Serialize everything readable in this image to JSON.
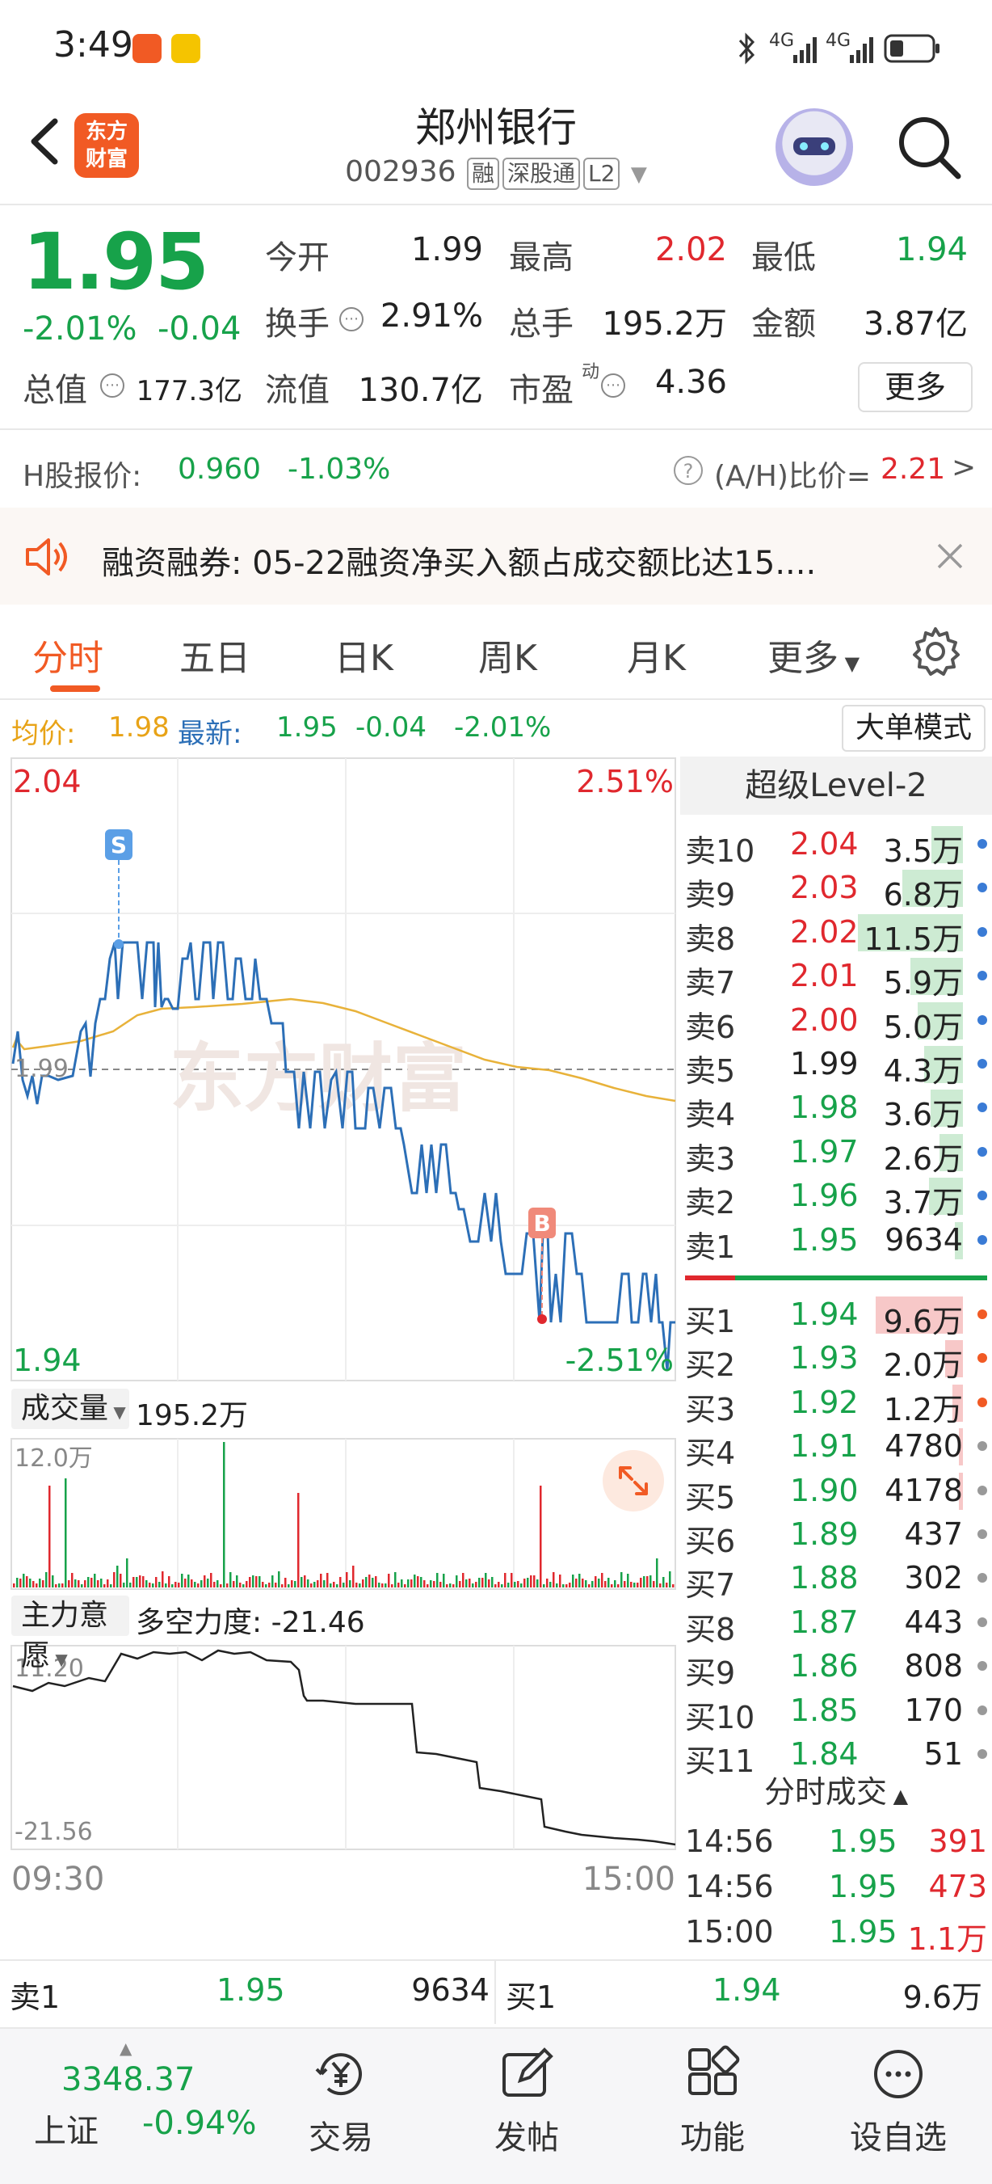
{
  "status_bar": {
    "time": "3:49",
    "signal_1": "4G",
    "signal_2": "4G"
  },
  "header": {
    "logo_line1": "东方",
    "logo_line2": "财富",
    "stock_name": "郑州银行",
    "stock_code": "002936",
    "tags": [
      "融",
      "深股通",
      "L2"
    ]
  },
  "quote": {
    "price": "1.95",
    "change_pct": "-2.01%",
    "change_abs": "-0.04",
    "open_label": "今开",
    "open": "1.99",
    "high_label": "最高",
    "high": "2.02",
    "low_label": "最低",
    "low": "1.94",
    "turnover_label": "换手",
    "turnover": "2.91%",
    "volume_label": "总手",
    "volume": "195.2万",
    "amount_label": "金额",
    "amount": "3.87亿",
    "mktcap_label": "总值",
    "mktcap": "177.3亿",
    "float_label": "流值",
    "float": "130.7亿",
    "pe_label": "市盈",
    "pe_sup": "动",
    "pe": "4.36",
    "more_button": "更多"
  },
  "hshare": {
    "label": "H股报价:",
    "price": "0.960",
    "change": "-1.03%",
    "ratio_label": "(A/H)比价=",
    "ratio": "2.21",
    "arrow": ">"
  },
  "notice": {
    "text": "融资融券:  05-22融资净买入额占成交额比达15...."
  },
  "tabs": [
    "分时",
    "五日",
    "日K",
    "周K",
    "月K",
    "更多"
  ],
  "avg_line": {
    "avg_label": "均价:",
    "avg": "1.98",
    "latest_label": "最新:",
    "latest": "1.95",
    "chg": "-0.04",
    "pct": "-2.01%",
    "big_order_button": "大单模式"
  },
  "chart": {
    "price_top": "2.04",
    "pct_top": "2.51%",
    "price_bottom": "1.94",
    "pct_bottom": "-2.51%",
    "prev_close_label": "1.99",
    "marker_sell": "S",
    "marker_buy": "B",
    "volume_selector": "成交量",
    "volume_total": "195.2万",
    "volume_axis_max": "12.0万",
    "indicator_selector": "主力意愿",
    "indicator_text": "多空力度: -21.46",
    "indicator_max": "11.20",
    "indicator_min": "-21.56",
    "time_start": "09:30",
    "time_end": "15:00",
    "watermark": "东方财富"
  },
  "chart_data": {
    "type": "line",
    "x_range": [
      "09:30",
      "15:00"
    ],
    "ylim": [
      1.94,
      2.04
    ],
    "prev_close": 1.99,
    "series": [],
    "volume_max": 120000,
    "indicator_range": [
      -21.56,
      11.2
    ]
  },
  "order_book": {
    "title": "超级Level-2",
    "asks": [
      {
        "label": "卖10",
        "price": "2.04",
        "vol": "3.5万",
        "bar": 0.3
      },
      {
        "label": "卖9",
        "price": "2.03",
        "vol": "6.8万",
        "bar": 0.58
      },
      {
        "label": "卖8",
        "price": "2.02",
        "vol": "11.5万",
        "bar": 1.0
      },
      {
        "label": "卖7",
        "price": "2.01",
        "vol": "5.9万",
        "bar": 0.5
      },
      {
        "label": "卖6",
        "price": "2.00",
        "vol": "5.0万",
        "bar": 0.43
      },
      {
        "label": "卖5",
        "price": "1.99",
        "vol": "4.3万",
        "bar": 0.37
      },
      {
        "label": "卖4",
        "price": "1.98",
        "vol": "3.6万",
        "bar": 0.31
      },
      {
        "label": "卖3",
        "price": "1.97",
        "vol": "2.6万",
        "bar": 0.22
      },
      {
        "label": "卖2",
        "price": "1.96",
        "vol": "3.7万",
        "bar": 0.32
      },
      {
        "label": "卖1",
        "price": "1.95",
        "vol": "9634",
        "bar": 0.08
      }
    ],
    "bids": [
      {
        "label": "买1",
        "price": "1.94",
        "vol": "9.6万",
        "bar": 0.83
      },
      {
        "label": "买2",
        "price": "1.93",
        "vol": "2.0万",
        "bar": 0.17
      },
      {
        "label": "买3",
        "price": "1.92",
        "vol": "1.2万",
        "bar": 0.1
      },
      {
        "label": "买4",
        "price": "1.91",
        "vol": "4780",
        "bar": 0.04
      },
      {
        "label": "买5",
        "price": "1.90",
        "vol": "4178",
        "bar": 0.04
      },
      {
        "label": "买6",
        "price": "1.89",
        "vol": "437",
        "bar": 0
      },
      {
        "label": "买7",
        "price": "1.88",
        "vol": "302",
        "bar": 0
      },
      {
        "label": "买8",
        "price": "1.87",
        "vol": "443",
        "bar": 0
      },
      {
        "label": "买9",
        "price": "1.86",
        "vol": "808",
        "bar": 0
      },
      {
        "label": "买10",
        "price": "1.85",
        "vol": "170",
        "bar": 0
      },
      {
        "label": "买11",
        "price": "1.84",
        "vol": "51",
        "bar": 0
      }
    ],
    "trades_title": "分时成交",
    "trades": [
      {
        "time": "14:56",
        "price": "1.95",
        "vol": "391"
      },
      {
        "time": "14:56",
        "price": "1.95",
        "vol": "473"
      },
      {
        "time": "15:00",
        "price": "1.95",
        "vol": "1.1万"
      }
    ]
  },
  "bid_strip": {
    "ask_label": "卖1",
    "ask_price": "1.95",
    "ask_vol": "9634",
    "bid_label": "买1",
    "bid_price": "1.94",
    "bid_vol": "9.6万"
  },
  "navbar": {
    "index_value": "3348.37",
    "index_name": "上证",
    "index_change": "-0.94%",
    "items": [
      "交易",
      "发帖",
      "功能",
      "设自选"
    ]
  },
  "colors": {
    "up": "#e0282e",
    "down": "#17a24a",
    "accent": "#f15a24",
    "price_line": "#2c6fb7",
    "avg_line": "#e8b23a"
  }
}
